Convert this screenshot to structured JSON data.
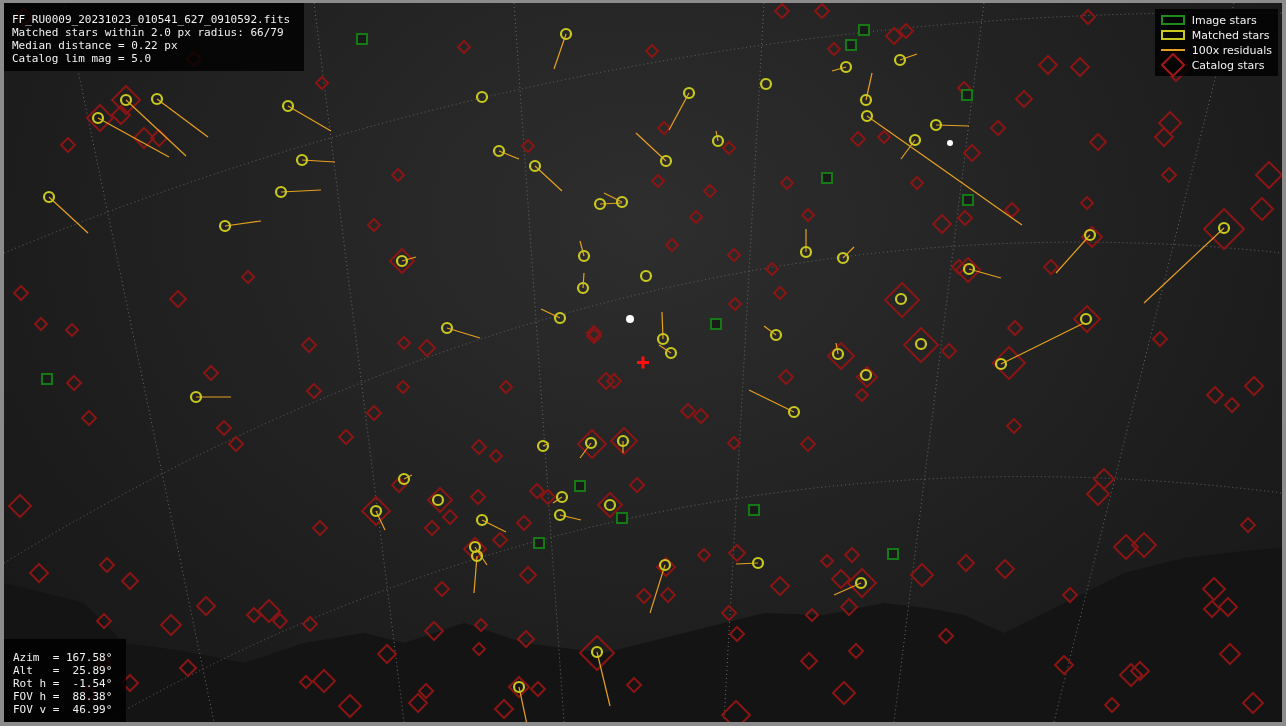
{
  "info_box": {
    "lines": [
      "FF_RU0009_20231023_010541_627_0910592.fits",
      "Matched stars within 2.0 px radius: 66/79",
      "Median distance = 0.22 px",
      "Catalog lim mag = 5.0"
    ]
  },
  "legend": {
    "items": [
      {
        "kind": "image",
        "label": "Image stars"
      },
      {
        "kind": "matched",
        "label": "Matched stars"
      },
      {
        "kind": "residual",
        "label": "100x residuals"
      },
      {
        "kind": "catalog",
        "label": "Catalog stars"
      }
    ]
  },
  "pointing_box": {
    "lines": [
      "Azim  = 167.58°",
      "Alt   =  25.89°",
      "Rot h =  -1.54°",
      "FOV h =  88.38°",
      "FOV v =  46.99°"
    ]
  }
}
